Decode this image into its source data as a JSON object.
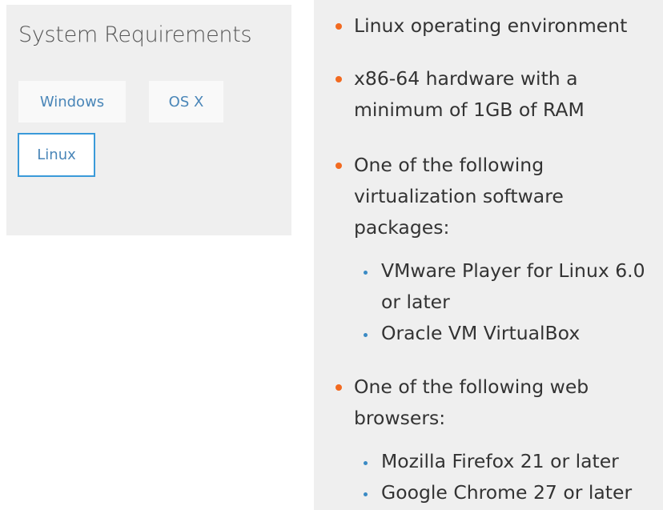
{
  "system_requirements": {
    "title": "System Requirements",
    "tabs": [
      {
        "label": "Windows",
        "active": false
      },
      {
        "label": "OS X",
        "active": false
      },
      {
        "label": "Linux",
        "active": true
      }
    ]
  },
  "linux_requirements": {
    "items": [
      {
        "lines": [
          "Linux operating environment"
        ]
      },
      {
        "lines": [
          "x86-64 hardware with a",
          "minimum of 1GB of RAM"
        ]
      },
      {
        "lines": [
          "One of the following",
          "virtualization software",
          "packages:"
        ],
        "subitems": [
          {
            "lines": [
              "VMware Player for Linux 6.0",
              "or later"
            ]
          },
          {
            "lines": [
              "Oracle VM VirtualBox"
            ]
          }
        ]
      },
      {
        "lines": [
          "One of the following web",
          "browsers:"
        ],
        "subitems": [
          {
            "lines": [
              "Mozilla Firefox 21 or later"
            ]
          },
          {
            "lines": [
              "Google Chrome 27 or later"
            ]
          }
        ]
      }
    ]
  },
  "colors": {
    "panel_bg": "#efefef",
    "tab_text": "#4a86b8",
    "active_border": "#3a9ad9",
    "bullet_orange": "#f26a20",
    "sub_bullet_blue": "#3a8ac4",
    "body_text": "#333333"
  }
}
